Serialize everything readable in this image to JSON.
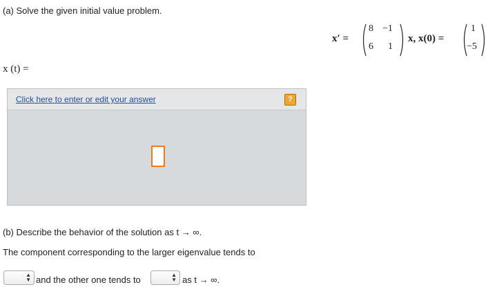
{
  "part_a": {
    "label": "(a) Solve the given initial value problem.",
    "answer_prefix": "x (t) ="
  },
  "equation": {
    "lhs": "x′ =",
    "matrix": [
      "8",
      "−1",
      "6",
      "1"
    ],
    "after_matrix": "x, x(0) =",
    "initial_vector": [
      "1",
      "−5"
    ]
  },
  "answer_box": {
    "link_text": "Click here to enter or edit your answer",
    "help_icon": "?"
  },
  "part_b": {
    "label": "(b) Describe the behavior of the solution as t → ∞.",
    "sentence": "The component corresponding to the larger eigenvalue tends to",
    "middle_text": "and the other one tends to",
    "end_text": "as t → ∞.",
    "select_1_value": "",
    "select_2_value": ""
  },
  "icons": {
    "help": "question-mark-icon",
    "select_arrow": "updown-arrow-icon"
  },
  "colors": {
    "link": "#1f4f9e",
    "help_badge": "#f0a637",
    "cursor_box": "#f07b1a",
    "panel_bg": "#d7dadd"
  }
}
